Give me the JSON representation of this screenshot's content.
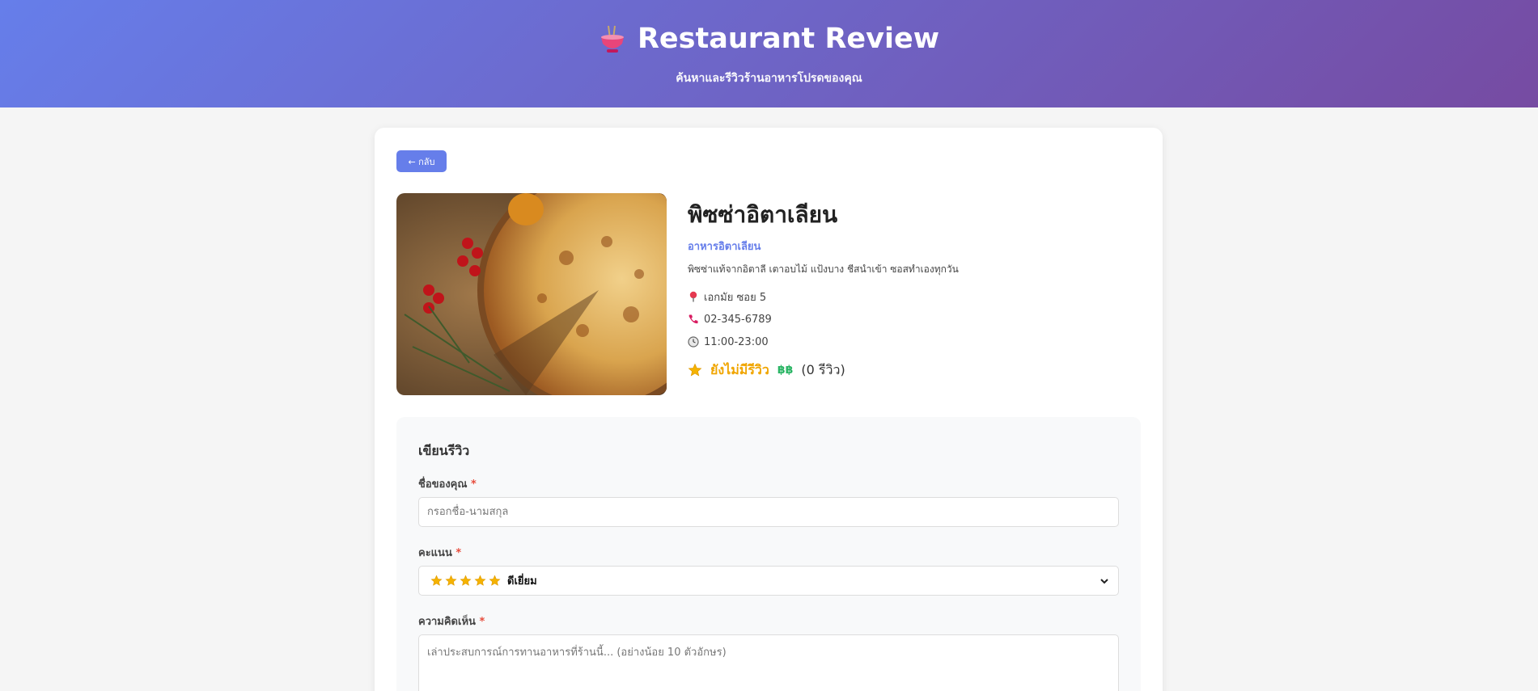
{
  "header": {
    "title": "Restaurant Review",
    "subtitle": "ค้นหาและรีวิวร้านอาหารโปรดของคุณ",
    "logo_icon": "noodle-bowl-icon"
  },
  "restaurant": {
    "back_label": "← กลับ",
    "name": "พิซซ่าอิตาเลียน",
    "category": "อาหารอิตาเลียน",
    "description": "พิซซ่าแท้จากอิตาลี เตาอบไม้ แป้งบาง ชีสนำเข้า ซอสทำเองทุกวัน",
    "address": "เอกมัย ซอย 5",
    "phone": "02-345-6789",
    "hours": "11:00-23:00",
    "rating_text": "ยังไม่มีรีวิว",
    "price": "฿฿",
    "review_count": "(0 รีวิว)"
  },
  "review_form": {
    "heading": "เขียนรีวิว",
    "name_label": "ชื่อของคุณ",
    "name_placeholder": "กรอกชื่อ-นามสกุล",
    "required_mark": "*",
    "rating_label": "คะแนน",
    "rating_selected": "ดีเยี่ยม",
    "rating_stars": 5,
    "comment_label": "ความคิดเห็น",
    "comment_placeholder": "เล่าประสบการณ์การทานอาหารที่ร้านนี้... (อย่างน้อย 10 ตัวอักษร)"
  },
  "colors": {
    "accent": "#667eea",
    "header_gradient_end": "#764ba2",
    "star": "#f0a500",
    "price": "#28b463",
    "required": "#e74c3c"
  }
}
